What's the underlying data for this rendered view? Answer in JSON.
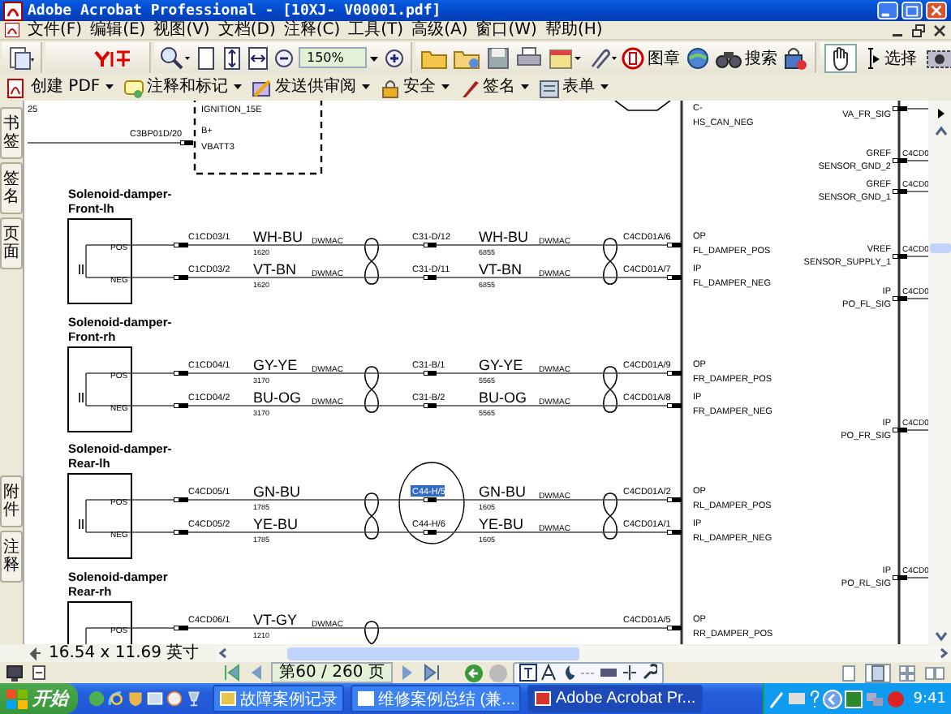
{
  "window": {
    "title": "Adobe Acrobat Professional - [10XJ- V00001.pdf]"
  },
  "menu": [
    "文件(F)",
    "编辑(E)",
    "视图(V)",
    "文档(D)",
    "注释(C)",
    "工具(T)",
    "高级(A)",
    "窗口(W)",
    "帮助(H)"
  ],
  "toolbar": {
    "zoom": "150%",
    "stamp": "图章",
    "search": "搜索"
  },
  "tools": [
    {
      "kind": "hand",
      "selected": true
    },
    {
      "kind": "select",
      "label": "选择",
      "selected": false
    }
  ],
  "tasks_toolbar": [
    "创建 PDF",
    "注释和标记",
    "发送供审阅",
    "安全",
    "签名",
    "表单"
  ],
  "nav_tabs": [
    "书签",
    "签名",
    "页面"
  ],
  "nav_tabs_lower": [
    "附件",
    "注释"
  ],
  "diagram": {
    "page_number": "25",
    "ignition_box": [
      "IGNITION_15E",
      "B+",
      "VBATT3"
    ],
    "feed_connector": "C3BP01D/20",
    "top_pin": {
      "type": "C-",
      "signal": "HS_CAN_NEG"
    },
    "components": [
      {
        "title": [
          "Solenoid-damper-",
          "Front-lh"
        ],
        "circled": false,
        "wires": [
          {
            "pin": "POS",
            "connector_1": "C1CD03/1",
            "color_1": "WH-BU",
            "circuit_1": "1620",
            "shield_1": "DWMAC",
            "connector_2": "C31-D/12",
            "selected": false,
            "color_2": "WH-BU",
            "circuit_2": "6855",
            "shield_2": "DWMAC",
            "connector_3": "C4CD01A/6",
            "pin_type": "OP",
            "signal": "FL_DAMPER_POS"
          },
          {
            "pin": "NEG",
            "connector_1": "C1CD03/2",
            "color_1": "VT-BN",
            "circuit_1": "1620",
            "shield_1": "DWMAC",
            "connector_2": "C31-D/11",
            "selected": false,
            "color_2": "VT-BN",
            "circuit_2": "6855",
            "shield_2": "DWMAC",
            "connector_3": "C4CD01A/7",
            "pin_type": "IP",
            "signal": "FL_DAMPER_NEG"
          }
        ]
      },
      {
        "title": [
          "Solenoid-damper-",
          "Front-rh"
        ],
        "circled": false,
        "wires": [
          {
            "pin": "POS",
            "connector_1": "C1CD04/1",
            "color_1": "GY-YE",
            "circuit_1": "3170",
            "shield_1": "DWMAC",
            "connector_2": "C31-B/1",
            "selected": false,
            "color_2": "GY-YE",
            "circuit_2": "5565",
            "shield_2": "DWMAC",
            "connector_3": "C4CD01A/9",
            "pin_type": "OP",
            "signal": "FR_DAMPER_POS"
          },
          {
            "pin": "NEG",
            "connector_1": "C1CD04/2",
            "color_1": "BU-OG",
            "circuit_1": "3170",
            "shield_1": "DWMAC",
            "connector_2": "C31-B/2",
            "selected": false,
            "color_2": "BU-OG",
            "circuit_2": "5565",
            "shield_2": "DWMAC",
            "connector_3": "C4CD01A/8",
            "pin_type": "IP",
            "signal": "FR_DAMPER_NEG"
          }
        ]
      },
      {
        "title": [
          "Solenoid-damper-",
          "Rear-lh"
        ],
        "circled": true,
        "wires": [
          {
            "pin": "POS",
            "connector_1": "C4CD05/1",
            "color_1": "GN-BU",
            "circuit_1": "1785",
            "connector_2": "C44-H/5",
            "selected": true,
            "color_2": "GN-BU",
            "circuit_2": "1605",
            "shield_2": "DWMAC",
            "connector_3": "C4CD01A/2",
            "pin_type": "OP",
            "signal": "RL_DAMPER_POS"
          },
          {
            "pin": "NEG",
            "connector_1": "C4CD05/2",
            "color_1": "YE-BU",
            "circuit_1": "1785",
            "connector_2": "C44-H/6",
            "selected": false,
            "color_2": "YE-BU",
            "circuit_2": "1605",
            "shield_2": "DWMAC",
            "connector_3": "C4CD01A/1",
            "pin_type": "IP",
            "signal": "RL_DAMPER_NEG"
          }
        ]
      },
      {
        "title": [
          "Solenoid-damper",
          "Rear-rh"
        ],
        "circled": false,
        "wires": [
          {
            "pin": "POS",
            "connector_1": "C4CD06/1",
            "color_1": "VT-GY",
            "circuit_1": "1210",
            "shield_1": "DWMAC",
            "connector_3": "C4CD01A/5",
            "pin_type": "OP",
            "signal": "RR_DAMPER_POS",
            "selected": false
          }
        ]
      }
    ],
    "right_pins": [
      {
        "signal": "VA_FR_SIG"
      },
      {
        "type": "GREF",
        "signal": "SENSOR_GND_2",
        "connector": "C4CD0"
      },
      {
        "type": "GREF",
        "signal": "SENSOR_GND_1",
        "connector": "C4CD0"
      },
      {
        "type": "VREF",
        "signal": "SENSOR_SUPPLY_1",
        "connector": "C4CD0"
      },
      {
        "type": "IP",
        "signal": "PO_FL_SIG",
        "connector": "C4CD0"
      },
      {
        "type": "IP",
        "signal": "PO_FR_SIG",
        "connector": "C4CD0"
      },
      {
        "type": "IP",
        "signal": "PO_RL_SIG",
        "connector": "C4CD0"
      }
    ]
  },
  "status": {
    "page_size": "16.54 x 11.69 英寸",
    "page_field": "第60 / 260 页"
  },
  "taskbar": {
    "start": "开始",
    "tasks": [
      {
        "kind": "folder",
        "label": "故障案例记录",
        "selected": false
      },
      {
        "kind": "document",
        "label": "维修案例总结 (兼...",
        "selected": false
      },
      {
        "kind": "pdf",
        "label": "Adobe Acrobat Pr...",
        "selected": true
      }
    ],
    "clock": "9:41"
  }
}
